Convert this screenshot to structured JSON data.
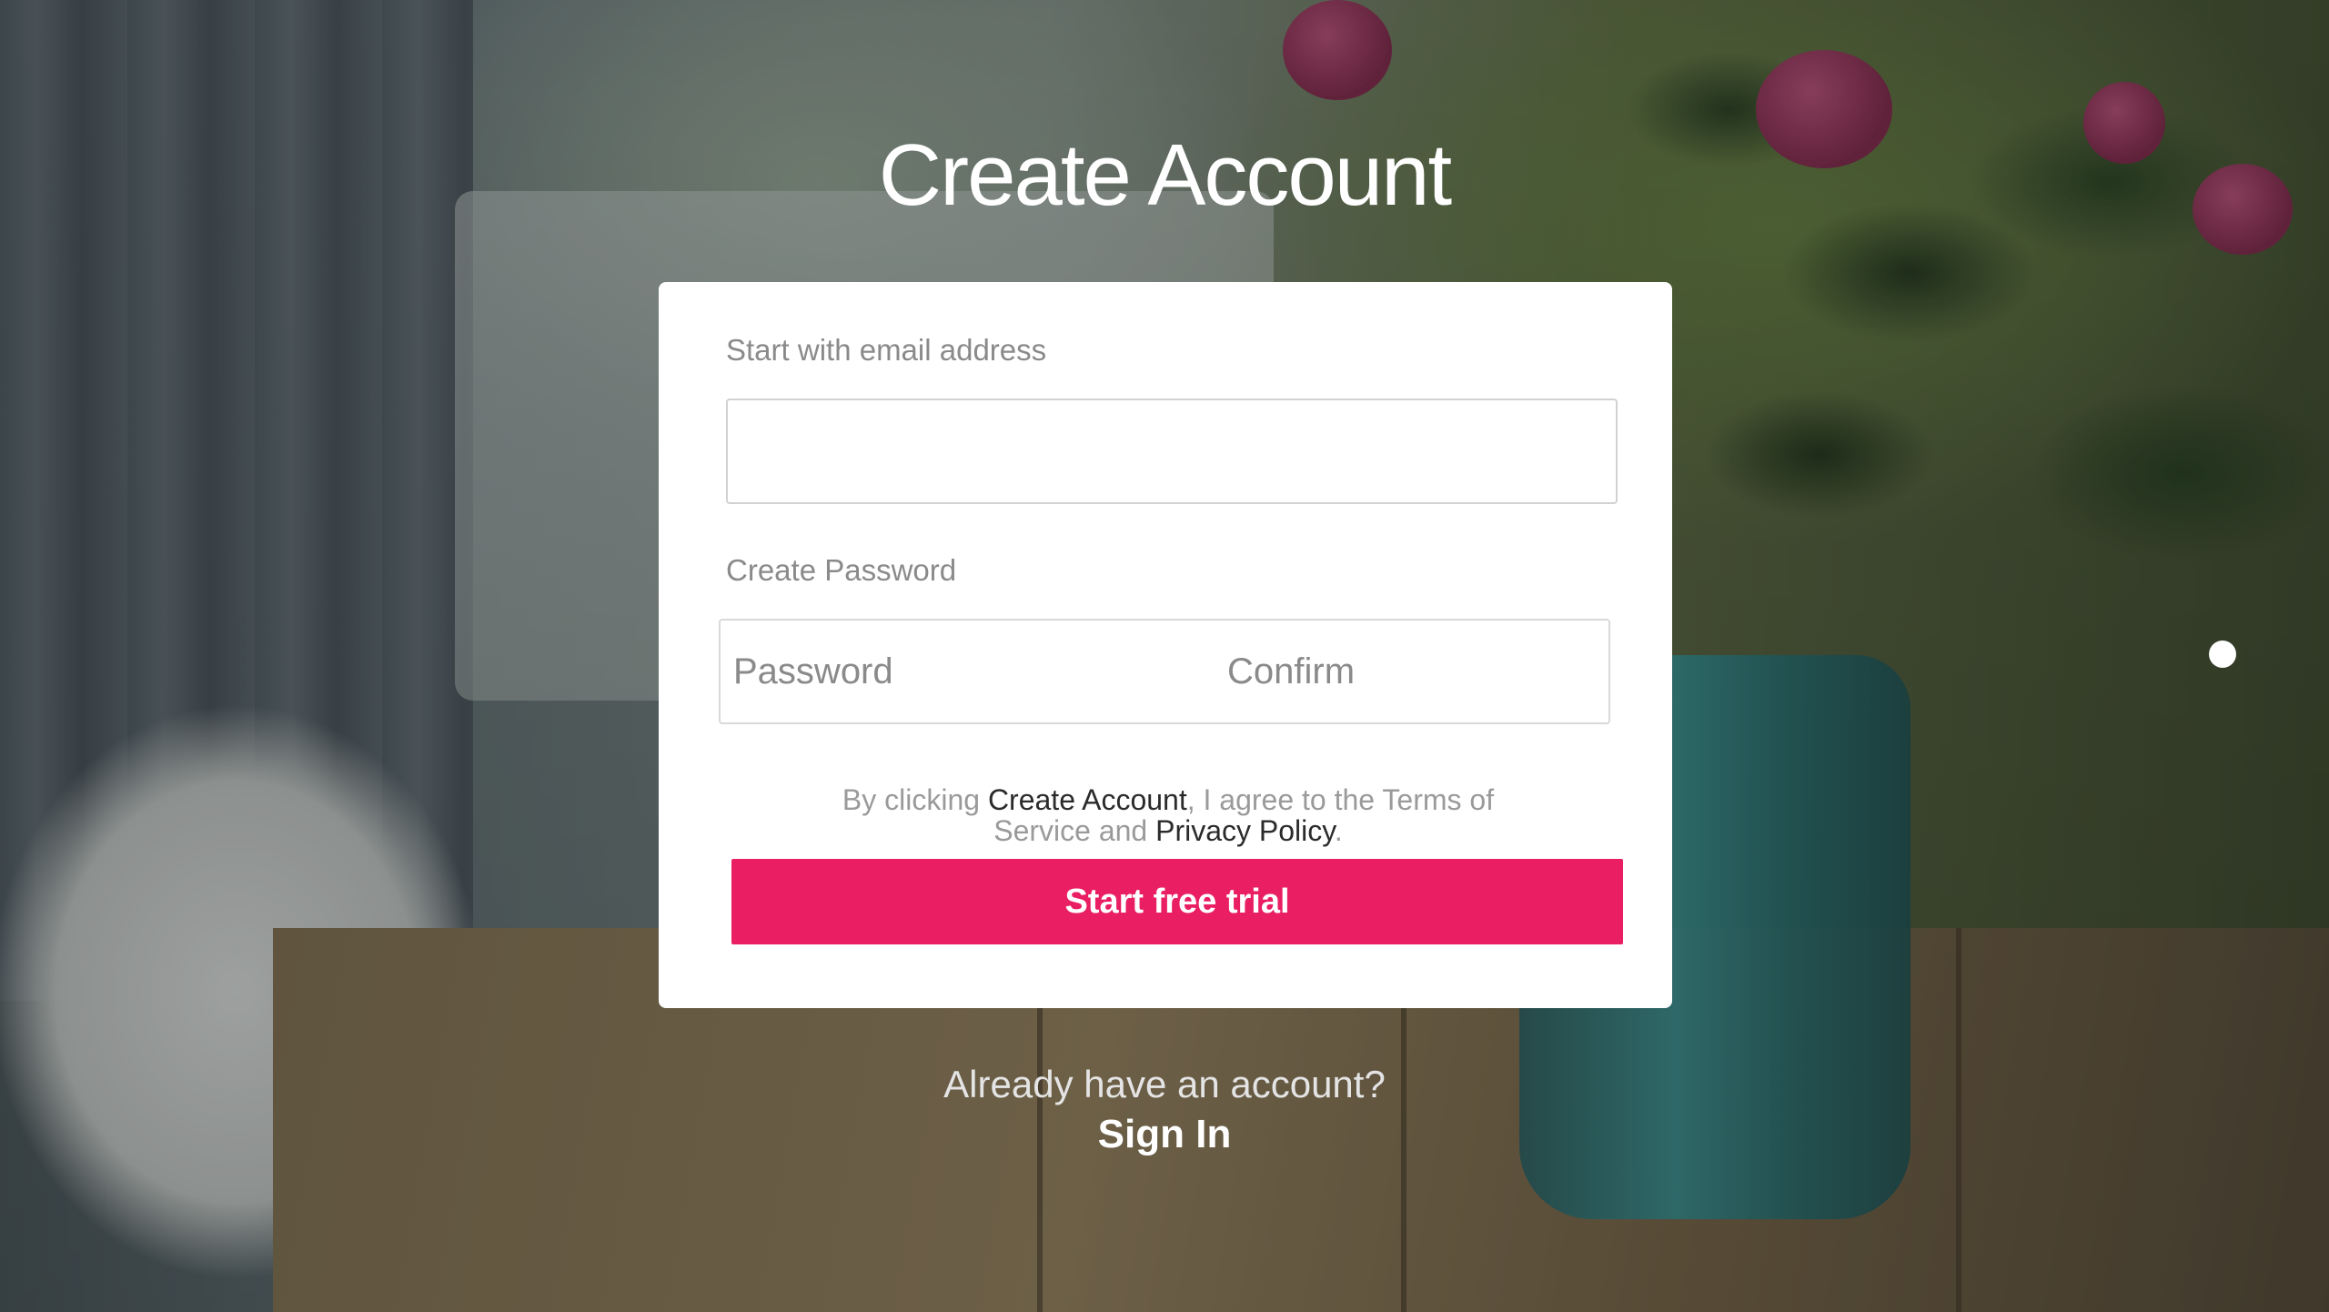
{
  "page": {
    "title": "Create Account"
  },
  "form": {
    "email_label": "Start with email address",
    "email_value": "",
    "email_placeholder": "",
    "password_label": "Create Password",
    "password_placeholder": "Password",
    "confirm_placeholder": "Confirm",
    "terms_prefix": "By clicking ",
    "terms_link_create": "Create Account",
    "terms_middle": ", I agree to the Terms of Service and ",
    "terms_link_privacy": "Privacy Policy",
    "terms_suffix": ".",
    "submit_label": "Start free trial"
  },
  "footer": {
    "already_text": "Already have an account?",
    "signin_label": "Sign In"
  },
  "colors": {
    "accent": "#e91e63",
    "card_bg": "#ffffff",
    "label_gray": "#8a8a8a",
    "link_dark": "#2b2b2b"
  },
  "icons": {
    "indicator": "dot-indicator-icon"
  }
}
